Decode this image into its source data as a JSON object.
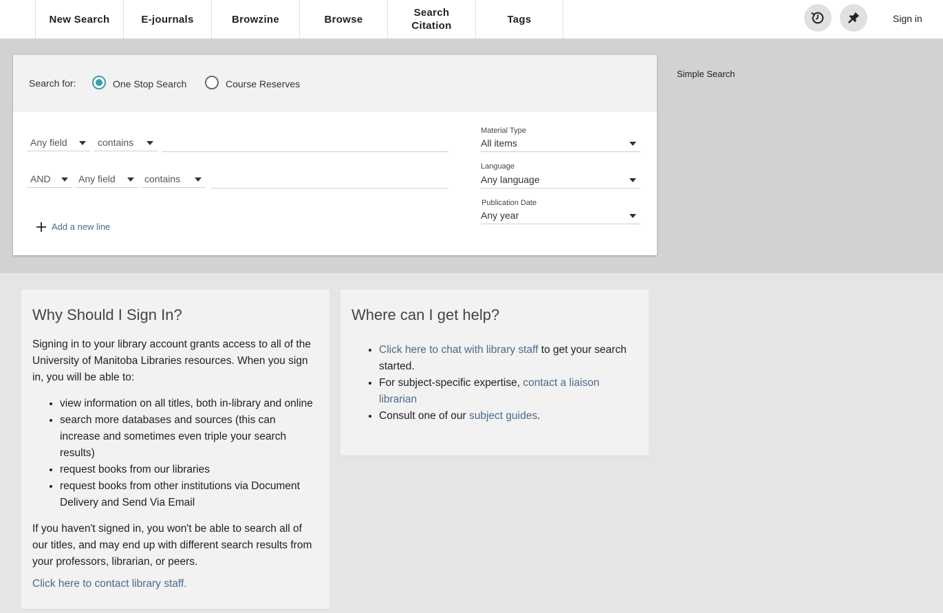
{
  "nav": {
    "items": [
      "New Search",
      "E-journals",
      "Browzine",
      "Browse",
      "Search\nCitation",
      "Tags"
    ],
    "history_icon": "history-icon",
    "pin_icon": "pin-icon",
    "signin": "Sign in"
  },
  "search": {
    "search_for_label": "Search for:",
    "scope_options": [
      "One Stop Search",
      "Course Reserves"
    ],
    "selected_scope": "One Stop Search",
    "row1": {
      "field": "Any field",
      "operator": "contains",
      "value": ""
    },
    "row2": {
      "boolean": "AND",
      "field": "Any field",
      "operator": "contains",
      "value": ""
    },
    "add_line": "Add a new line",
    "filters": {
      "material_type_label": "Material Type",
      "material_type_value": "All items",
      "language_label": "Language",
      "language_value": "Any language",
      "pub_date_label": "Publication Date",
      "pub_date_value": "Any year"
    },
    "simple_search_link": "Simple Search"
  },
  "signin_box": {
    "title": "Why Should I Sign In?",
    "intro": "Signing in to your library account grants access to all of the University of Manitoba Libraries resources. When you sign in, you will be able to:",
    "bullets": [
      "view information on all titles, both in-library and online",
      "search more databases and sources (this can increase and sometimes even triple your search results)",
      "request books from our libraries",
      "request books from other institutions via Document Delivery and Send Via Email"
    ],
    "outro": "If you haven't signed in, you won't be able to search all of our titles, and may end up with different search results from your professors, librarian, or peers.",
    "contact_link": "Click here to contact library staff."
  },
  "help_box": {
    "title": "Where can I get help?",
    "b1_link": "Click here to chat with library staff",
    "b1_text": " to get your search started.",
    "b2_text": "For subject-specific expertise, ",
    "b2_link": "contact a liaison librarian",
    "b3_text": "Consult one of our ",
    "b3_link": "subject guides",
    "b3_end": "."
  },
  "colors": {
    "accent": "#3a9ca8",
    "link": "#4a6a8c",
    "band": "#d2d2d2",
    "page": "#e5e5e5"
  }
}
